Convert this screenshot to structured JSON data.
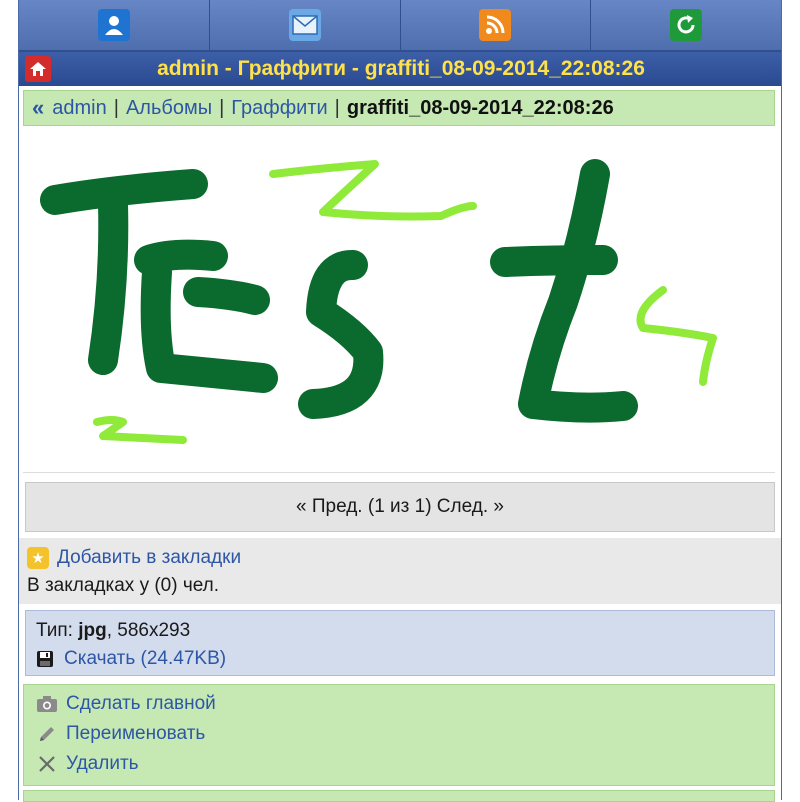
{
  "nav": {
    "icons": [
      "user-icon",
      "mail-icon",
      "rss-icon",
      "refresh-icon"
    ]
  },
  "header": {
    "title": "admin - Граффити - graffiti_08-09-2014_22:08:26"
  },
  "breadcrumb": {
    "back": "«",
    "items": [
      "admin",
      "Альбомы",
      "Граффити"
    ],
    "separator": "|",
    "current": "graffiti_08-09-2014_22:08:26"
  },
  "pager": {
    "text": "« Пред. (1 из 1) След. »"
  },
  "bookmarks": {
    "add_label": "Добавить в закладки",
    "count_text": "В закладках у (0) чел."
  },
  "file": {
    "type_label": "Тип:",
    "type_value": "jpg",
    "dimensions": ", 586x293",
    "download_label": "Скачать (24.47KB)"
  },
  "actions": {
    "make_main": "Сделать главной",
    "rename": "Переименовать",
    "delete": "Удалить"
  },
  "colors": {
    "graffiti_dark": "#0b6a2e",
    "graffiti_light": "#8fea3a",
    "title_text": "#ffe14a",
    "link": "#2d56a5"
  }
}
